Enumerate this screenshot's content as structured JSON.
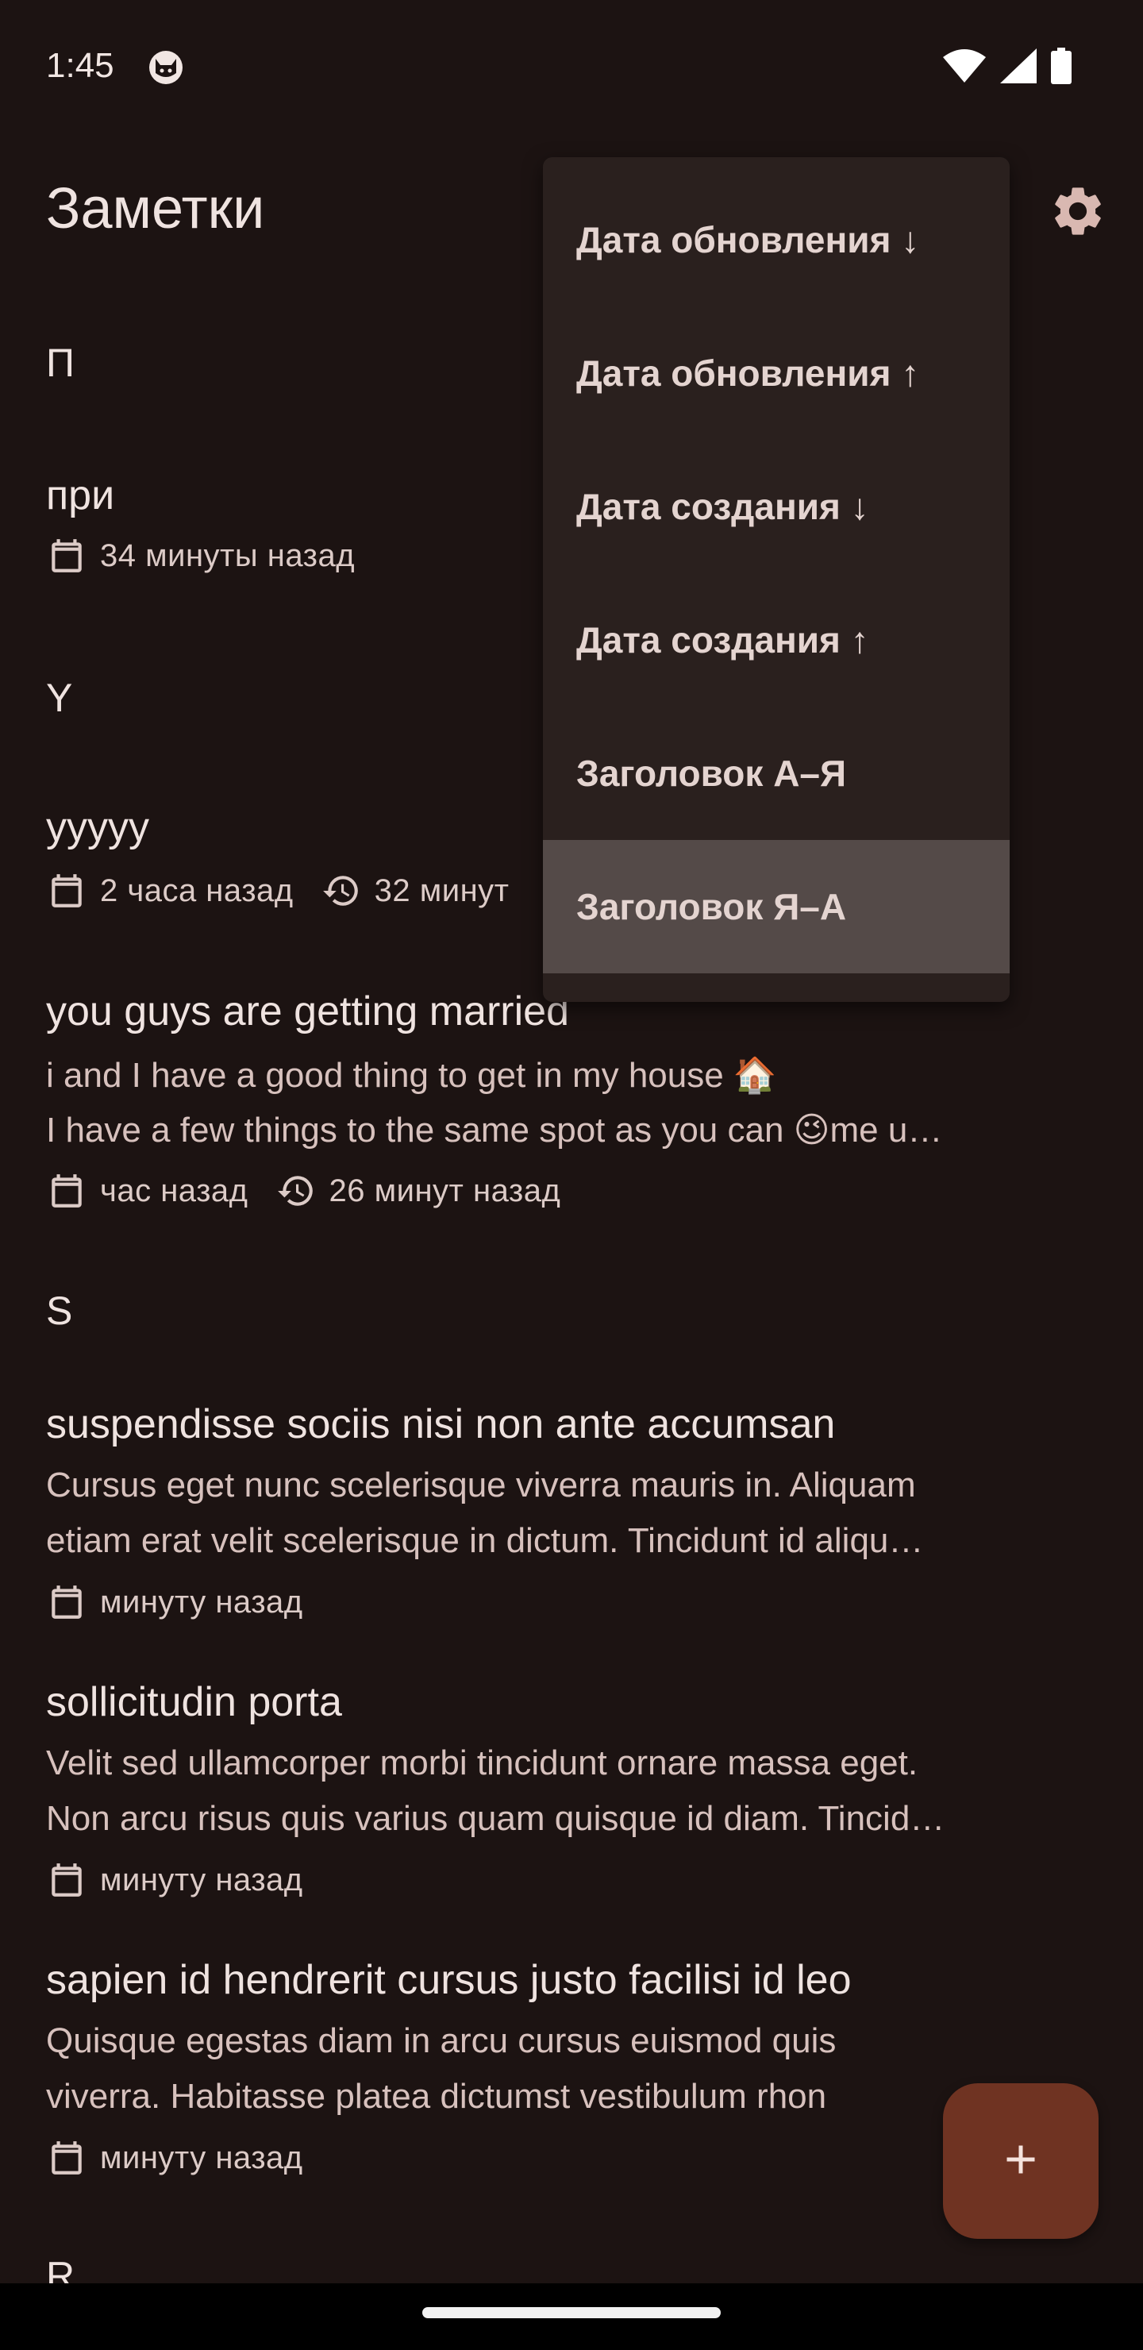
{
  "status_bar": {
    "time": "1:45",
    "icons": [
      "cat-face-icon",
      "wifi-icon",
      "cellular-signal-icon",
      "battery-icon"
    ]
  },
  "app_bar": {
    "title": "Заметки",
    "settings_icon": "gear-icon"
  },
  "sort_menu": {
    "items": [
      {
        "label": "Дата обновления ↓",
        "selected": false
      },
      {
        "label": "Дата обновления ↑",
        "selected": false
      },
      {
        "label": "Дата создания ↓",
        "selected": false
      },
      {
        "label": "Дата создания ↑",
        "selected": false
      },
      {
        "label": "Заголовок А–Я",
        "selected": false
      },
      {
        "label": "Заголовок Я–А",
        "selected": true
      }
    ]
  },
  "notes_list": {
    "sections": [
      {
        "header": "П",
        "notes": [
          {
            "title": "при",
            "created": "34 минуты назад"
          }
        ]
      },
      {
        "header": "Y",
        "notes": [
          {
            "title": "yyyyy",
            "created": "2 часа назад",
            "updated": "32 минут"
          },
          {
            "title": "you guys are getting married",
            "body_line1": "i and I have a good thing to get in my house 🏠",
            "body_line2": "I have a few things to the same spot as you can 😉me u…",
            "created": "час назад",
            "updated": "26 минут назад"
          }
        ]
      },
      {
        "header": "S",
        "notes": [
          {
            "title": "suspendisse sociis nisi non ante accumsan",
            "body_line1": "Cursus eget nunc scelerisque viverra mauris in. Aliquam",
            "body_line2": "etiam erat velit scelerisque in dictum. Tincidunt id aliqu…",
            "created": "минуту назад"
          },
          {
            "title": "sollicitudin porta",
            "body_line1": "Velit sed ullamcorper morbi tincidunt ornare massa eget.",
            "body_line2": "Non arcu risus quis varius quam quisque id diam. Tincid…",
            "created": "минуту назад"
          },
          {
            "title": "sapien id hendrerit cursus justo facilisi id leo",
            "body_line1": "Quisque egestas diam in arcu cursus euismod quis",
            "body_line2": "viverra. Habitasse platea dictumst vestibulum rhon",
            "created": "минуту назад"
          }
        ]
      },
      {
        "header": "R",
        "notes": []
      }
    ]
  },
  "fab": {
    "icon": "plus-icon"
  },
  "colors": {
    "background": "#1c1312",
    "menu_background": "#2a201e",
    "menu_selected": "#544a48",
    "fab": "#6f3322",
    "text_primary": "#efe3e0",
    "text_secondary": "#d7c1bd"
  }
}
